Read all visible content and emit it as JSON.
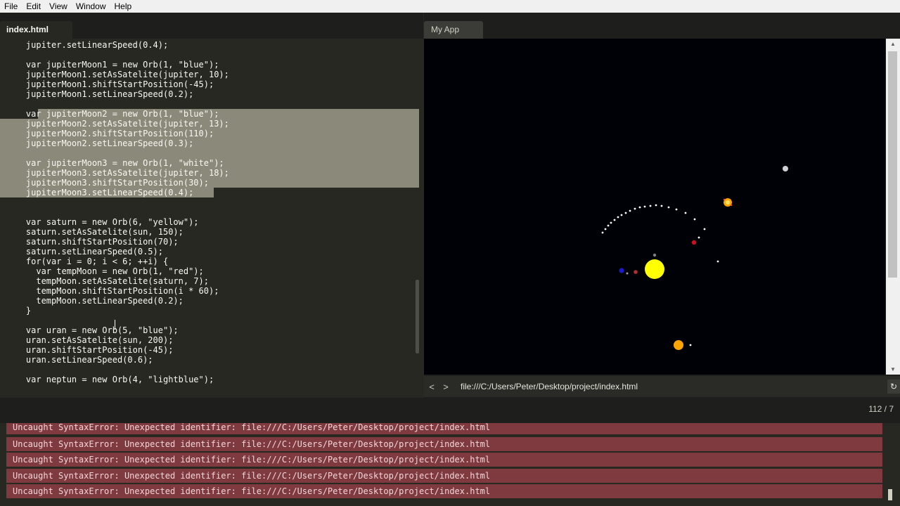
{
  "menu": [
    "File",
    "Edit",
    "View",
    "Window",
    "Help"
  ],
  "editor": {
    "tab": "index.html",
    "lines": [
      {
        "t": "    jupiter.setLinearSpeed(0.4);",
        "s": 0
      },
      {
        "t": "",
        "s": 0
      },
      {
        "t": "    var jupiterMoon1 = new Orb(1, \"blue\");",
        "s": 0
      },
      {
        "t": "    jupiterMoon1.setAsSatelite(jupiter, 10);",
        "s": 0
      },
      {
        "t": "    jupiterMoon1.shiftStartPosition(-45);",
        "s": 0
      },
      {
        "t": "    jupiterMoon1.setLinearSpeed(0.2);",
        "s": 0
      },
      {
        "t": "",
        "s": 0
      },
      {
        "t": "    var jupiterMoon2 = new Orb(1, \"blue\");",
        "s": 1
      },
      {
        "t": "    jupiterMoon2.setAsSatelite(jupiter, 13);",
        "s": 2
      },
      {
        "t": "    jupiterMoon2.shiftStartPosition(110);",
        "s": 2
      },
      {
        "t": "    jupiterMoon2.setLinearSpeed(0.3);",
        "s": 2
      },
      {
        "t": "",
        "s": 2
      },
      {
        "t": "    var jupiterMoon3 = new Orb(1, \"white\");",
        "s": 2
      },
      {
        "t": "    jupiterMoon3.setAsSatelite(jupiter, 18);",
        "s": 2
      },
      {
        "t": "    jupiterMoon3.shiftStartPosition(30);",
        "s": 2
      },
      {
        "t": "    jupiterMoon3.setLinearSpeed(0.4);",
        "s": 3
      },
      {
        "t": "",
        "s": 0
      },
      {
        "t": "",
        "s": 0
      },
      {
        "t": "    var saturn = new Orb(6, \"yellow\");",
        "s": 0
      },
      {
        "t": "    saturn.setAsSatelite(sun, 150);",
        "s": 0
      },
      {
        "t": "    saturn.shiftStartPosition(70);",
        "s": 0
      },
      {
        "t": "    saturn.setLinearSpeed(0.5);",
        "s": 0
      },
      {
        "t": "    for(var i = 0; i < 6; ++i) {",
        "s": 0
      },
      {
        "t": "      var tempMoon = new Orb(1, \"red\");",
        "s": 0
      },
      {
        "t": "      tempMoon.setAsSatelite(saturn, 7);",
        "s": 0
      },
      {
        "t": "      tempMoon.shiftStartPosition(i * 60);",
        "s": 0
      },
      {
        "t": "      tempMoon.setLinearSpeed(0.2);",
        "s": 0
      },
      {
        "t": "    }",
        "s": 0
      },
      {
        "t": "",
        "s": 0
      },
      {
        "t": "    var uran = new Orb(5, \"blue\");",
        "s": 0
      },
      {
        "t": "    uran.setAsSatelite(sun, 200);",
        "s": 0
      },
      {
        "t": "    uran.shiftStartPosition(-45);",
        "s": 0
      },
      {
        "t": "    uran.setLinearSpeed(0.6);",
        "s": 0
      },
      {
        "t": "",
        "s": 0
      },
      {
        "t": "    var neptun = new Orb(4, \"lightblue\");",
        "s": 0
      }
    ]
  },
  "preview": {
    "tab": "My App",
    "back": "<",
    "forward": ">",
    "url": "file:///C:/Users/Peter/Desktop/project/index.html",
    "reload": "↻",
    "background": "#000007"
  },
  "status": {
    "counter": "112 / 7"
  },
  "console": {
    "errors": [
      "Uncaught SyntaxError: Unexpected identifier: file:///C:/Users/Peter/Desktop/project/index.html",
      "Uncaught SyntaxError: Unexpected identifier: file:///C:/Users/Peter/Desktop/project/index.html",
      "Uncaught SyntaxError: Unexpected identifier: file:///C:/Users/Peter/Desktop/project/index.html",
      "Uncaught SyntaxError: Unexpected identifier: file:///C:/Users/Peter/Desktop/project/index.html",
      "Uncaught SyntaxError: Unexpected identifier: file:///C:/Users/Peter/Desktop/project/index.html"
    ],
    "error_bg": "#7e3a3f"
  },
  "colors": {
    "editor_bg": "#272822",
    "selection": "#8b8a7a",
    "sun": "#ffff00",
    "saturn": "#ffa500"
  }
}
